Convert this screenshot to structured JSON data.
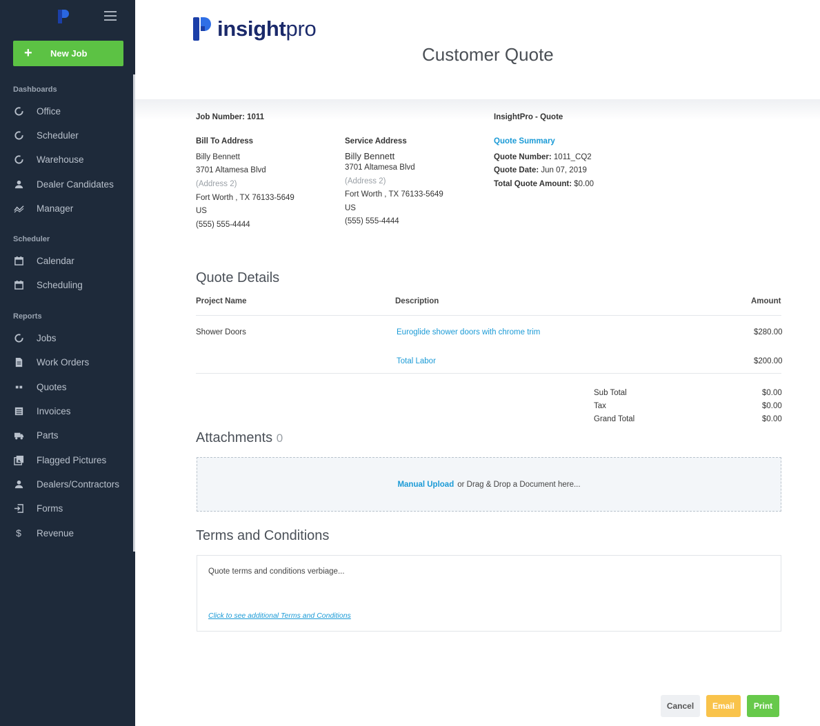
{
  "sidebar": {
    "new_job_label": "New Job",
    "sections": {
      "dashboards": "Dashboards",
      "scheduler": "Scheduler",
      "reports": "Reports"
    },
    "items": {
      "office": "Office",
      "scheduler": "Scheduler",
      "warehouse": "Warehouse",
      "dealer_candidates": "Dealer Candidates",
      "manager": "Manager",
      "calendar": "Calendar",
      "scheduling": "Scheduling",
      "jobs": "Jobs",
      "work_orders": "Work Orders",
      "quotes": "Quotes",
      "invoices": "Invoices",
      "parts": "Parts",
      "flagged_pictures": "Flagged Pictures",
      "dealers_contractors": "Dealers/Contractors",
      "forms": "Forms",
      "revenue": "Revenue"
    }
  },
  "brand": {
    "bold": "insight",
    "light": "pro"
  },
  "page_title": "Customer Quote",
  "job": {
    "job_number": "Job Number: 1011",
    "quote_header": "InsightPro - Quote"
  },
  "bill_to": {
    "heading": "Bill To Address",
    "name": "Billy Bennett",
    "address1": "3701 Altamesa Blvd",
    "address2": "(Address 2)",
    "city_line": "Fort Worth , TX 76133-5649",
    "country": "US",
    "phone": "(555) 555-4444"
  },
  "service": {
    "heading": "Service Address",
    "name": "Billy Bennett",
    "address1": "3701 Altamesa Blvd",
    "address2": "(Address 2)",
    "city_line": "Fort Worth , TX 76133-5649",
    "country": "US",
    "phone": "(555) 555-4444"
  },
  "summary": {
    "heading": "Quote Summary",
    "quote_number_label": "Quote Number:",
    "quote_number": "1011_CQ2",
    "quote_date_label": "Quote Date:",
    "quote_date": "Jun 07, 2019",
    "total_label": "Total Quote Amount:",
    "total": "$0.00"
  },
  "details": {
    "heading": "Quote Details",
    "columns": {
      "project": "Project Name",
      "description": "Description",
      "amount": "Amount"
    },
    "rows": [
      {
        "project": "Shower Doors",
        "description": "Euroglide shower doors with chrome trim",
        "amount": "$280.00"
      },
      {
        "project": "",
        "description": "Total Labor",
        "amount": "$200.00"
      }
    ],
    "totals": {
      "subtotal_label": "Sub Total",
      "subtotal": "$0.00",
      "tax_label": "Tax",
      "tax": "$0.00",
      "grand_label": "Grand Total",
      "grand": "$0.00"
    }
  },
  "attachments": {
    "heading": "Attachments",
    "count": "0",
    "upload_link": "Manual Upload",
    "drop_text": "or Drag & Drop a Document here..."
  },
  "terms": {
    "heading": "Terms and Conditions",
    "text": "Quote terms and conditions verbiage...",
    "link": "Click to see additional Terms and Conditions"
  },
  "actions": {
    "cancel": "Cancel",
    "email": "Email",
    "print": "Print"
  },
  "colors": {
    "sidebar_bg": "#1e2a3a",
    "primary_green": "#5cc244",
    "link_blue": "#1a9ad6",
    "email_yellow": "#f9c34b",
    "brand_navy": "#1b2a6b"
  }
}
